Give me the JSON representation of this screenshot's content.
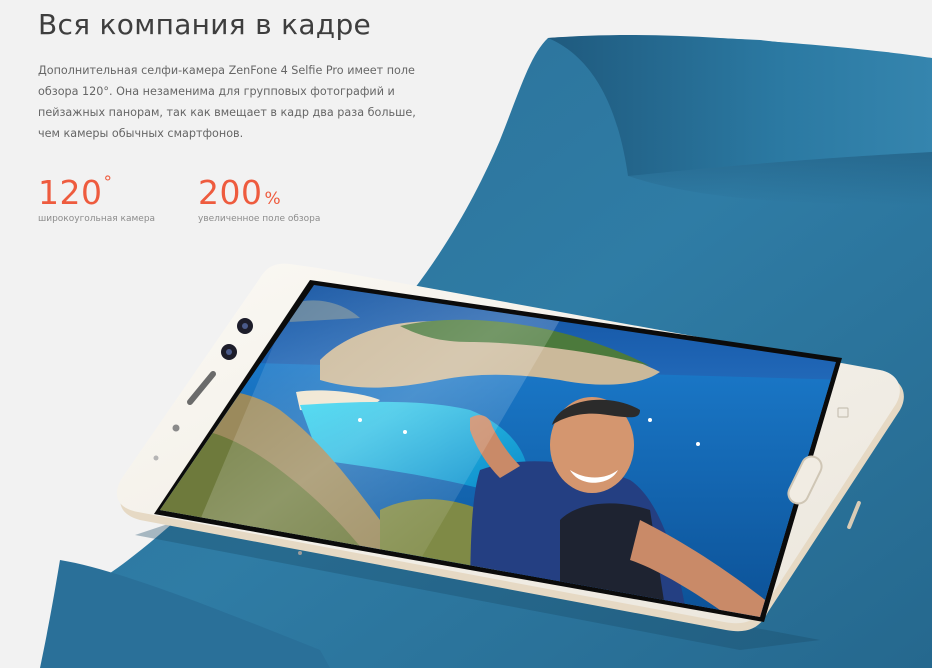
{
  "hero": {
    "title": "Вся компания в кадре",
    "description": "Дополнительная селфи-камера ZenFone 4 Selfie Pro имеет поле обзора 120°. Она незаменима для групповых фотографий и пейзажных панорам, так как вмещает в кадр два раза больше, чем камеры обычных смартфонов."
  },
  "stats": [
    {
      "value": "120",
      "unit": "°",
      "caption": "широкоугольная камера"
    },
    {
      "value": "200",
      "unit": "%",
      "caption": "увеличенное поле обзора"
    }
  ],
  "colors": {
    "accent": "#ee5b3e",
    "paper": "#2f7aa3",
    "phone_body": "#f7f4ee"
  }
}
